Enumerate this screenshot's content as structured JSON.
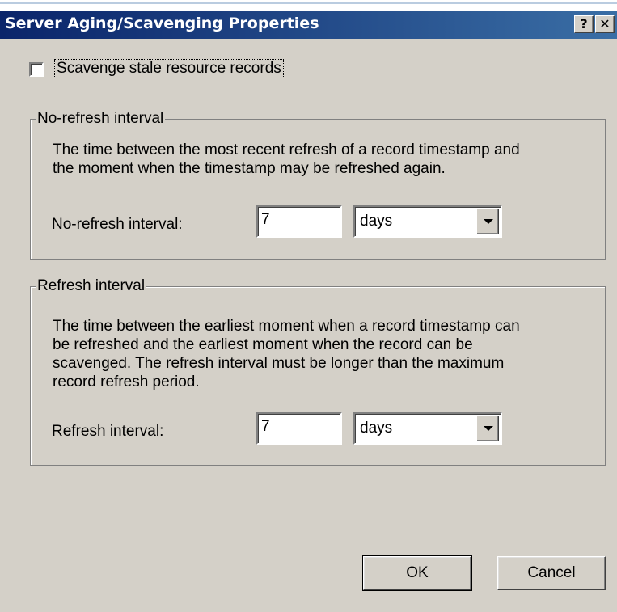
{
  "window": {
    "title": "Server Aging/Scavenging Properties",
    "help_button": "?",
    "close_button": "✕"
  },
  "scavenge": {
    "label_accel": "S",
    "label_rest": "cavenge stale resource records",
    "checked": false
  },
  "no_refresh": {
    "group_title": "No-refresh interval",
    "description_line1": "The time between the most recent refresh of a record timestamp and",
    "description_line2": "the moment when the timestamp may be refreshed again.",
    "field_label_accel": "N",
    "field_label_rest": "o-refresh interval:",
    "value": "7",
    "unit": "days"
  },
  "refresh": {
    "group_title": "Refresh interval",
    "description_line1": "The time between the earliest moment when a record timestamp can",
    "description_line2": "be refreshed and the earliest moment when the record can be",
    "description_line3": "scavenged. The refresh interval must be longer than the maximum",
    "description_line4": "record refresh period.",
    "field_label_accel": "R",
    "field_label_rest": "efresh interval:",
    "value": "7",
    "unit": "days"
  },
  "buttons": {
    "ok": "OK",
    "cancel": "Cancel"
  }
}
